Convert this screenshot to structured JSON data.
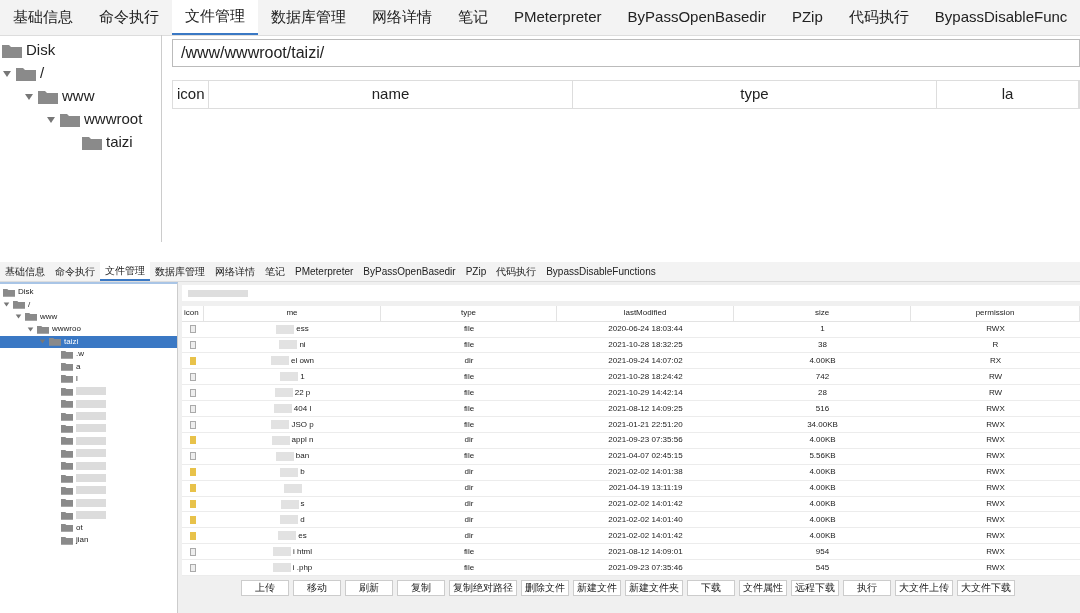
{
  "top": {
    "tabs": [
      {
        "label": "基础信息",
        "selected": false
      },
      {
        "label": "命令执行",
        "selected": false
      },
      {
        "label": "文件管理",
        "selected": true
      },
      {
        "label": "数据库管理",
        "selected": false
      },
      {
        "label": "网络详情",
        "selected": false
      },
      {
        "label": "笔记",
        "selected": false
      },
      {
        "label": "PMeterpreter",
        "selected": false
      },
      {
        "label": "ByPassOpenBasedir",
        "selected": false
      },
      {
        "label": "PZip",
        "selected": false
      },
      {
        "label": "代码执行",
        "selected": false
      },
      {
        "label": "BypassDisableFunc",
        "selected": false
      }
    ],
    "tree": [
      {
        "name": "Disk",
        "selected": false
      },
      {
        "name": "/",
        "expanded": true,
        "selected": false,
        "children": [
          {
            "name": "www",
            "expanded": true,
            "selected": false,
            "children": [
              {
                "name": "wwwroot",
                "expanded": true,
                "selected": false,
                "children": [
                  {
                    "name": "taizi",
                    "selected": false
                  }
                ]
              }
            ]
          }
        ]
      }
    ],
    "path": "/www/wwwroot/taizi/",
    "columns": [
      "icon",
      "name",
      "type",
      "la"
    ]
  },
  "bottom": {
    "tabs": [
      {
        "label": "基础信息",
        "selected": false
      },
      {
        "label": "命令执行",
        "selected": false
      },
      {
        "label": "文件管理",
        "selected": true
      },
      {
        "label": "数据库管理",
        "selected": false
      },
      {
        "label": "网络详情",
        "selected": false
      },
      {
        "label": "笔记",
        "selected": false
      },
      {
        "label": "PMeterpreter",
        "selected": false
      },
      {
        "label": "ByPassOpenBasedir",
        "selected": false
      },
      {
        "label": "PZip",
        "selected": false
      },
      {
        "label": "代码执行",
        "selected": false
      },
      {
        "label": "BypassDisableFunctions",
        "selected": false
      }
    ],
    "tree": [
      {
        "name": "Disk",
        "selected": false
      },
      {
        "name": "/",
        "expanded": true,
        "selected": false,
        "children": [
          {
            "name": "www",
            "expanded": true,
            "selected": false,
            "children": [
              {
                "name": "wwwroo",
                "expanded": true,
                "selected": false,
                "children": [
                  {
                    "name": "taizi",
                    "expanded": true,
                    "selected": true,
                    "children": [
                      {
                        "name": ".w",
                        "selected": false
                      },
                      {
                        "name": "a",
                        "selected": false
                      },
                      {
                        "name": "l",
                        "selected": false
                      },
                      {
                        "selected": false
                      },
                      {
                        "selected": false
                      },
                      {
                        "selected": false
                      },
                      {
                        "selected": false
                      },
                      {
                        "selected": false
                      },
                      {
                        "selected": false
                      },
                      {
                        "selected": false
                      },
                      {
                        "selected": false
                      },
                      {
                        "selected": false
                      },
                      {
                        "selected": false
                      },
                      {
                        "selected": false
                      },
                      {
                        "name": "ot",
                        "selected": false
                      },
                      {
                        "name": "jian",
                        "selected": false
                      }
                    ]
                  }
                ]
              }
            ]
          }
        ]
      }
    ],
    "columns": [
      "icon",
      "me",
      "type",
      "lastModified",
      "size",
      "permission"
    ],
    "rows": [
      {
        "kind": "file",
        "name": "ess",
        "type": "file",
        "lastModified": "2020-06-24 18:03:44",
        "size": "1",
        "permission": "RWX"
      },
      {
        "kind": "file",
        "name": "ni",
        "type": "file",
        "lastModified": "2021-10-28 18:32:25",
        "size": "38",
        "permission": "R"
      },
      {
        "kind": "dir",
        "name": "el own",
        "type": "dir",
        "lastModified": "2021-09-24 14:07:02",
        "size": "4.00KB",
        "permission": "RX"
      },
      {
        "kind": "file",
        "name": "1",
        "type": "file",
        "lastModified": "2021-10-28 18:24:42",
        "size": "742",
        "permission": "RW"
      },
      {
        "kind": "file",
        "name": "22 p",
        "type": "file",
        "lastModified": "2021-10-29 14:42:14",
        "size": "28",
        "permission": "RW"
      },
      {
        "kind": "file",
        "name": "404 l",
        "type": "file",
        "lastModified": "2021-08-12 14:09:25",
        "size": "516",
        "permission": "RWX"
      },
      {
        "kind": "file",
        "name": "JSO p",
        "type": "file",
        "lastModified": "2021-01-21 22:51:20",
        "size": "34.00KB",
        "permission": "RWX"
      },
      {
        "kind": "dir",
        "name": "appl n",
        "type": "dir",
        "lastModified": "2021-09-23 07:35:56",
        "size": "4.00KB",
        "permission": "RWX"
      },
      {
        "kind": "file",
        "name": "ban",
        "type": "file",
        "lastModified": "2021-04-07 02:45:15",
        "size": "5.56KB",
        "permission": "RWX"
      },
      {
        "kind": "dir",
        "name": "b",
        "type": "dir",
        "lastModified": "2021-02-02 14:01:38",
        "size": "4.00KB",
        "permission": "RWX"
      },
      {
        "kind": "dir",
        "type": "dir",
        "lastModified": "2021-04-19 13:11:19",
        "size": "4.00KB",
        "permission": "RWX"
      },
      {
        "kind": "dir",
        "name": "s",
        "type": "dir",
        "lastModified": "2021-02-02 14:01:42",
        "size": "4.00KB",
        "permission": "RWX"
      },
      {
        "kind": "dir",
        "name": "d",
        "type": "dir",
        "lastModified": "2021-02-02 14:01:40",
        "size": "4.00KB",
        "permission": "RWX"
      },
      {
        "kind": "dir",
        "name": "es",
        "type": "dir",
        "lastModified": "2021-02-02 14:01:42",
        "size": "4.00KB",
        "permission": "RWX"
      },
      {
        "kind": "file",
        "name": "i html",
        "type": "file",
        "lastModified": "2021-08-12 14:09:01",
        "size": "954",
        "permission": "RWX"
      },
      {
        "kind": "file",
        "name": "i .php",
        "type": "file",
        "lastModified": "2021-09-23 07:35:46",
        "size": "545",
        "permission": "RWX"
      }
    ],
    "buttons": [
      "上传",
      "移动",
      "刷新",
      "复制",
      "复制绝对路径",
      "删除文件",
      "新建文件",
      "新建文件夹",
      "下载",
      "文件属性",
      "远程下载",
      "执行",
      "大文件上传",
      "大文件下载"
    ]
  }
}
